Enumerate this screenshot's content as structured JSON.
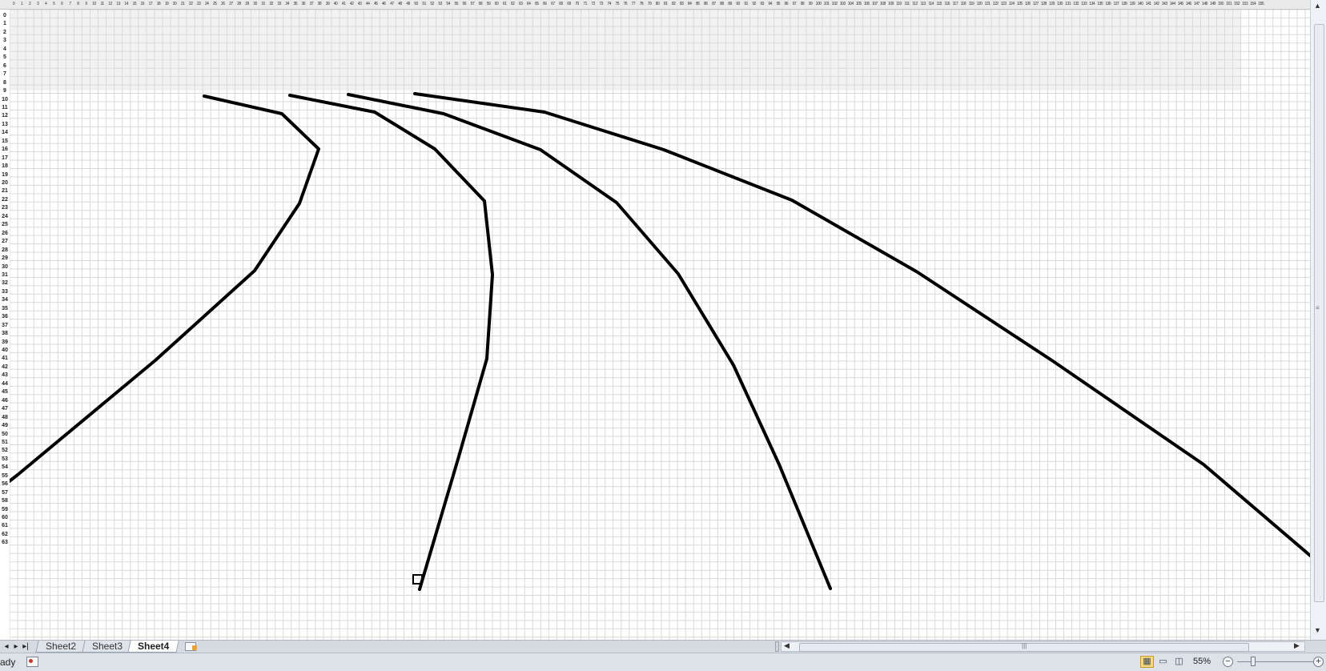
{
  "sheet": {
    "tabs": [
      {
        "label": "Sheet2",
        "active": false
      },
      {
        "label": "Sheet3",
        "active": false
      },
      {
        "label": "Sheet4",
        "active": true
      }
    ],
    "row_count_visible": 64,
    "col_count_visible": 156
  },
  "status": {
    "mode_text": "ady",
    "zoom_text": "55%",
    "zoom_out_label": "−",
    "zoom_in_label": "+"
  },
  "icons": {
    "macro": "macro-record-icon",
    "new_sheet": "insert-sheet-icon",
    "normal_view": "normal-view-icon",
    "page_layout": "page-layout-view-icon",
    "page_break": "page-break-view-icon"
  },
  "colors": {
    "grid_line": "#d9d9d9",
    "drawing_stroke": "#000000",
    "active_view": "#f9d97b"
  }
}
